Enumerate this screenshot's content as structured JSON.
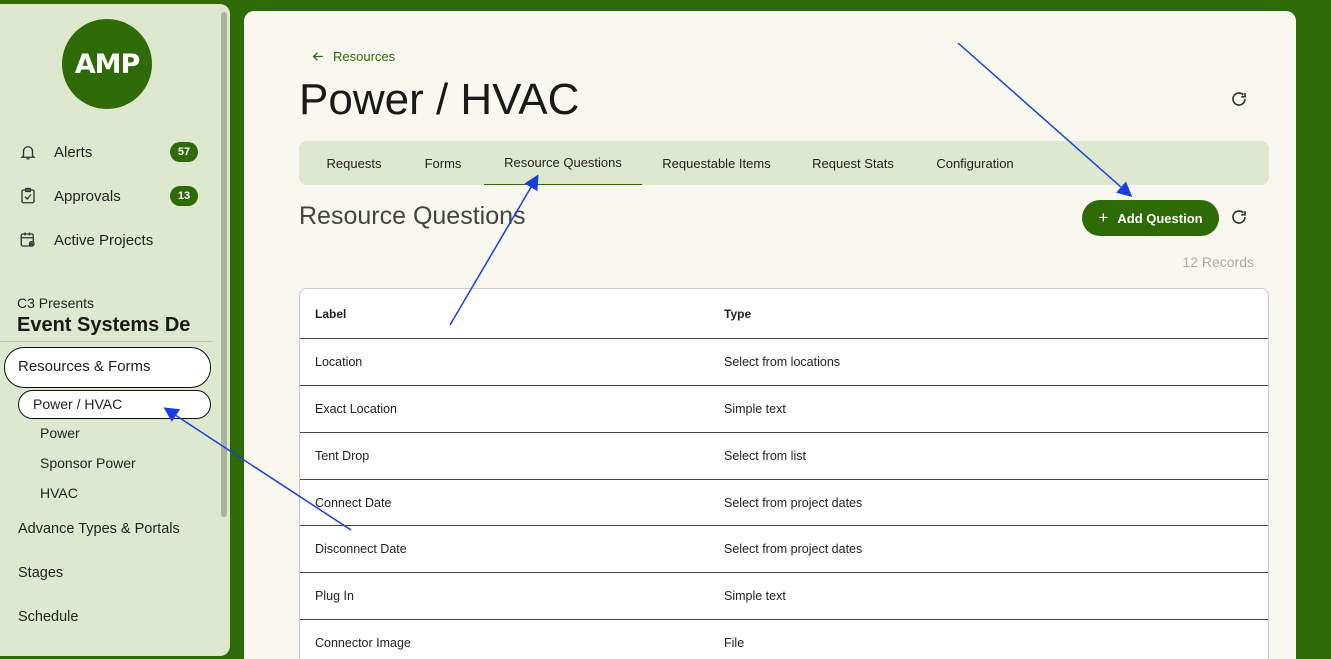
{
  "sidebar": {
    "logo_text": "AMP",
    "nav": [
      {
        "label": "Alerts",
        "badge": "57",
        "icon": "bell-icon"
      },
      {
        "label": "Approvals",
        "badge": "13",
        "icon": "clipboard-check-icon"
      },
      {
        "label": "Active Projects",
        "badge": "",
        "icon": "calendar-eye-icon"
      }
    ],
    "org_small": "C3 Presents",
    "org_big": "Event Systems De",
    "sections": {
      "resources_forms": "Resources & Forms",
      "current": "Power / HVAC",
      "sub_items": [
        "Power",
        "Sponsor Power",
        "HVAC"
      ],
      "advance_types": "Advance Types & Portals",
      "stages": "Stages",
      "schedule": "Schedule"
    }
  },
  "header": {
    "back_label": "Resources",
    "title": "Power / HVAC"
  },
  "tabs": [
    "Requests",
    "Forms",
    "Resource Questions",
    "Requestable Items",
    "Request Stats",
    "Configuration"
  ],
  "section": {
    "title": "Resource Questions",
    "add_button": "Add Question",
    "records": "12 Records"
  },
  "table": {
    "columns": [
      "Label",
      "Type"
    ],
    "rows": [
      [
        "Location",
        "Select from locations"
      ],
      [
        "Exact Location",
        "Simple text"
      ],
      [
        "Tent Drop",
        "Select from list"
      ],
      [
        "Connect Date",
        "Select from project dates"
      ],
      [
        "Disconnect Date",
        "Select from project dates"
      ],
      [
        "Plug In",
        "Simple text"
      ],
      [
        "Connector Image",
        "File"
      ]
    ]
  },
  "colors": {
    "brand": "#2e6b06",
    "sidebar_bg": "#dde8cf",
    "panel_bg": "#f8f7f0",
    "annotation": "#1a3fe0"
  }
}
